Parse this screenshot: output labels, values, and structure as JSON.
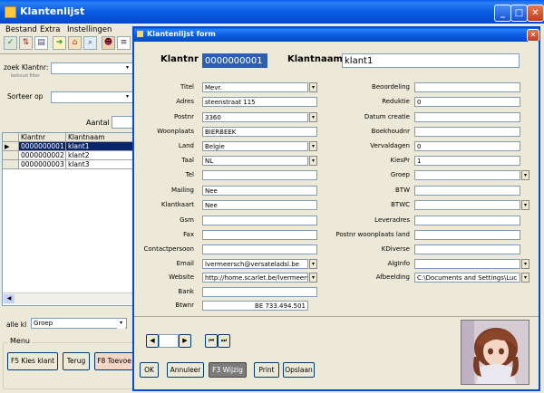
{
  "main": {
    "title": "Klantenlijst",
    "menu": [
      "Bestand",
      "Extra",
      "Instellingen"
    ],
    "search_label": "zoek Klantnr:",
    "search_hint": "behoud filter",
    "sort_label": "Sorteer op",
    "count_label": "Aantal",
    "grid_headers": [
      "Klantnr",
      "Klantnaam"
    ],
    "grid_rows": [
      {
        "nr": "0000000001",
        "naam": "klant1"
      },
      {
        "nr": "0000000002",
        "naam": "klant2"
      },
      {
        "nr": "0000000003",
        "naam": "klant3"
      }
    ],
    "filter_label": "alle kl",
    "filter_value": "Groep",
    "menu_group_label": "Menu",
    "btn_kies": "F5 Kies klant",
    "btn_terug": "Terug",
    "btn_toevoegen": "F8 Toevoe"
  },
  "form": {
    "title": "Klantenlijst form",
    "klantnr_label": "Klantnr",
    "klantnr_value": "0000000001",
    "klantnaam_label": "Klantnaam",
    "klantnaam_value": "klant1",
    "left": {
      "titel": {
        "label": "Titel",
        "value": "Mevr."
      },
      "adres": {
        "label": "Adres",
        "value": "steenstraat 115"
      },
      "postnr": {
        "label": "Postnr",
        "value": "3360"
      },
      "woonplaats": {
        "label": "Woonplaats",
        "value": "BIERBEEK"
      },
      "land": {
        "label": "Land",
        "value": "Belgie"
      },
      "taal": {
        "label": "Taal",
        "value": "NL"
      },
      "tel": {
        "label": "Tel",
        "value": ""
      },
      "mailing": {
        "label": "Mailing",
        "value": "Nee"
      },
      "klantkaart": {
        "label": "Klantkaart",
        "value": "Nee"
      },
      "gsm": {
        "label": "Gsm",
        "value": ""
      },
      "fax": {
        "label": "Fax",
        "value": ""
      },
      "contactpersoon": {
        "label": "Contactpersoon",
        "value": ""
      },
      "email": {
        "label": "Email",
        "value": "lvermeersch@versateladsl.be"
      },
      "website": {
        "label": "Website",
        "value": "http://home.scarlet.be/lvermeersch"
      },
      "bank": {
        "label": "Bank",
        "value": ""
      },
      "btwnr": {
        "label": "Btwnr",
        "value": "BE 733.494.501"
      }
    },
    "right": {
      "beoordeling": {
        "label": "Beoordeling",
        "value": ""
      },
      "reduktie": {
        "label": "Reduktie",
        "value": "0"
      },
      "datum_creatie": {
        "label": "Datum creatie",
        "value": ""
      },
      "boekhoudnr": {
        "label": "Boekhoudnr",
        "value": ""
      },
      "vervaldagen": {
        "label": "Vervaldagen",
        "value": "0"
      },
      "kiespr": {
        "label": "KiesPr",
        "value": "1"
      },
      "groep": {
        "label": "Groep",
        "value": ""
      },
      "btw": {
        "label": "BTW",
        "value": ""
      },
      "btwc": {
        "label": "BTWC",
        "value": ""
      },
      "leveradres": {
        "label": "Leveradres",
        "value": ""
      },
      "postnr_woonplaats_land": {
        "label": "Postnr woonplaats land",
        "value": ""
      },
      "kdiverse": {
        "label": "KDiverse",
        "value": ""
      },
      "alginfo": {
        "label": "AlgInfo",
        "value": ""
      },
      "afbeelding": {
        "label": "Afbeelding",
        "value": "C:\\Documents and Settings\\Luc Ve"
      }
    },
    "buttons": {
      "ok": "OK",
      "annuleer": "Annuleer",
      "wijzig": "F3 Wijzig",
      "print": "Print",
      "opslaan": "Opslaan"
    }
  }
}
